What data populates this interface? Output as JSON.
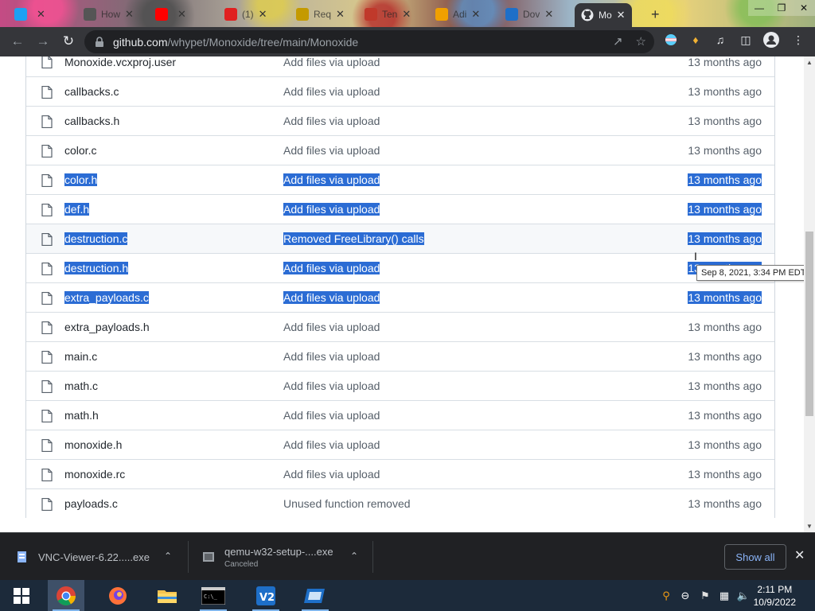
{
  "browser": {
    "tabs": [
      {
        "label": "",
        "icon": "twitter-icon",
        "color": "#1da1f2"
      },
      {
        "label": "How",
        "icon": "settings-gear-icon",
        "color": "#555555"
      },
      {
        "label": "",
        "icon": "youtube-icon",
        "color": "#ff0000"
      },
      {
        "label": "(1)",
        "icon": "notification-icon",
        "color": "#e02020"
      },
      {
        "label": "Req",
        "icon": "star-icon",
        "color": "#c49a00"
      },
      {
        "label": "Ten",
        "icon": "page-icon",
        "color": "#c0392b"
      },
      {
        "label": "Adi",
        "icon": "circle-icon",
        "color": "#f0a000"
      },
      {
        "label": "Dov",
        "icon": "virtualbox-icon",
        "color": "#1e6fc8"
      },
      {
        "label": "Mo",
        "icon": "github-icon",
        "color": "#e8eaed",
        "active": true
      }
    ],
    "url": {
      "host": "github.com",
      "path": "/whypet/Monoxide/tree/main/Monoxide"
    }
  },
  "files": [
    {
      "name": "Monoxide.vcxproj.user",
      "message": "Add files via upload",
      "age": "13 months ago",
      "selected": false
    },
    {
      "name": "callbacks.c",
      "message": "Add files via upload",
      "age": "13 months ago",
      "selected": false
    },
    {
      "name": "callbacks.h",
      "message": "Add files via upload",
      "age": "13 months ago",
      "selected": false
    },
    {
      "name": "color.c",
      "message": "Add files via upload",
      "age": "13 months ago",
      "selected": false
    },
    {
      "name": "color.h",
      "message": "Add files via upload",
      "age": "13 months ago",
      "selected": true
    },
    {
      "name": "def.h",
      "message": "Add files via upload",
      "age": "13 months ago",
      "selected": true
    },
    {
      "name": "destruction.c",
      "message": "Removed FreeLibrary() calls",
      "age": "13 months ago",
      "selected": true,
      "hovered": true
    },
    {
      "name": "destruction.h",
      "message": "Add files via upload",
      "age": "13 months ago",
      "selected": true
    },
    {
      "name": "extra_payloads.c",
      "message": "Add files via upload",
      "age": "13 months ago",
      "selected": true
    },
    {
      "name": "extra_payloads.h",
      "message": "Add files via upload",
      "age": "13 months ago",
      "selected": false
    },
    {
      "name": "main.c",
      "message": "Add files via upload",
      "age": "13 months ago",
      "selected": false
    },
    {
      "name": "math.c",
      "message": "Add files via upload",
      "age": "13 months ago",
      "selected": false
    },
    {
      "name": "math.h",
      "message": "Add files via upload",
      "age": "13 months ago",
      "selected": false
    },
    {
      "name": "monoxide.h",
      "message": "Add files via upload",
      "age": "13 months ago",
      "selected": false
    },
    {
      "name": "monoxide.rc",
      "message": "Add files via upload",
      "age": "13 months ago",
      "selected": false
    },
    {
      "name": "payloads.c",
      "message": "Unused function removed",
      "age": "13 months ago",
      "selected": false
    }
  ],
  "tooltip": "Sep 8, 2021, 3:34 PM EDT",
  "downloads": {
    "items": [
      {
        "name": "VNC-Viewer-6.22.....exe",
        "status": ""
      },
      {
        "name": "qemu-w32-setup-....exe",
        "status": "Canceled"
      }
    ],
    "show_all": "Show all"
  },
  "taskbar": {
    "time": "2:11 PM",
    "date": "10/9/2022"
  },
  "colors": {
    "selection": "#2b6cd4",
    "link_blue": "#8ab4f8"
  }
}
